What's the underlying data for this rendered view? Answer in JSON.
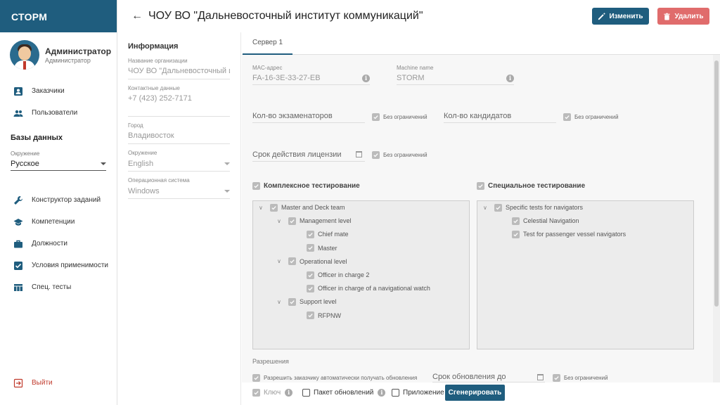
{
  "app": {
    "brand": "СТОРМ"
  },
  "user": {
    "name": "Администратор",
    "role": "Администратор"
  },
  "nav": {
    "top": [
      {
        "label": "Заказчики",
        "icon": "contact-icon"
      },
      {
        "label": "Пользователи",
        "icon": "users-icon"
      }
    ],
    "db_title": "Базы данных",
    "env_label": "Окружение",
    "env_value": "Русское",
    "bottom": [
      {
        "label": "Конструктор заданий",
        "icon": "wrench-icon"
      },
      {
        "label": "Компетенции",
        "icon": "graduation-cap-icon"
      },
      {
        "label": "Должности",
        "icon": "briefcase-icon"
      },
      {
        "label": "Условия применимости",
        "icon": "checkbox-icon"
      },
      {
        "label": "Спец. тесты",
        "icon": "table-icon"
      }
    ],
    "logout": "Выйти"
  },
  "header": {
    "title": "ЧОУ ВО \"Дальневосточный институт коммуникаций\"",
    "edit_label": "Изменить",
    "delete_label": "Удалить"
  },
  "info": {
    "title": "Информация",
    "org_label": "Название организации",
    "org_value": "ЧОУ ВО \"Дальневосточный институт коммуникаций\"",
    "contacts_label": "Контактные данные",
    "contacts_value": "+7 (423) 252-7171",
    "city_label": "Город",
    "city_value": "Владивосток",
    "env_label": "Окружение",
    "env_value": "English",
    "os_label": "Операционная система",
    "os_value": "Windows"
  },
  "main": {
    "tab": "Сервер 1",
    "mac_label": "MAC-адрес",
    "mac_value": "FA-16-3E-33-27-EB",
    "machine_label": "Machine name",
    "machine_value": "STORM",
    "examiners_label": "Кол-во экзаменаторов",
    "candidates_label": "Кол-во кандидатов",
    "license_label": "Срок действия лицензии",
    "no_limit": "Без ограничений",
    "complex_title": "Комплексное тестирование",
    "special_title": "Специальное тестирование",
    "complex_tree": [
      {
        "label": "Master and Deck team",
        "level": 0,
        "chevron": true
      },
      {
        "label": "Management level",
        "level": 1,
        "chevron": true
      },
      {
        "label": "Chief mate",
        "level": 2,
        "chevron": false
      },
      {
        "label": "Master",
        "level": 2,
        "chevron": false
      },
      {
        "label": "Operational level",
        "level": 1,
        "chevron": true
      },
      {
        "label": "Officer in charge 2",
        "level": 2,
        "chevron": false
      },
      {
        "label": "Officer in charge of a navigational watch",
        "level": 2,
        "chevron": false
      },
      {
        "label": "Support level",
        "level": 1,
        "chevron": true
      },
      {
        "label": "RFPNW",
        "level": 2,
        "chevron": false
      }
    ],
    "special_tree": [
      {
        "label": "Specific tests for navigators",
        "level": 0,
        "chevron": true
      },
      {
        "label": "Celestial Navigation",
        "level": 1,
        "chevron": false
      },
      {
        "label": "Test for passenger vessel navigators",
        "level": 1,
        "chevron": false
      }
    ],
    "permissions_title": "Разрешения",
    "auto_update_label": "Разрешить заказчику автоматически получать обновления",
    "update_until_label": "Срок обновления до",
    "key_label": "Ключ",
    "update_pack_label": "Пакет обновлений",
    "app_label": "Приложение",
    "generate_label": "Сгенерировать"
  },
  "colors": {
    "brand": "#1f5d7e",
    "danger": "#e06c6c"
  }
}
